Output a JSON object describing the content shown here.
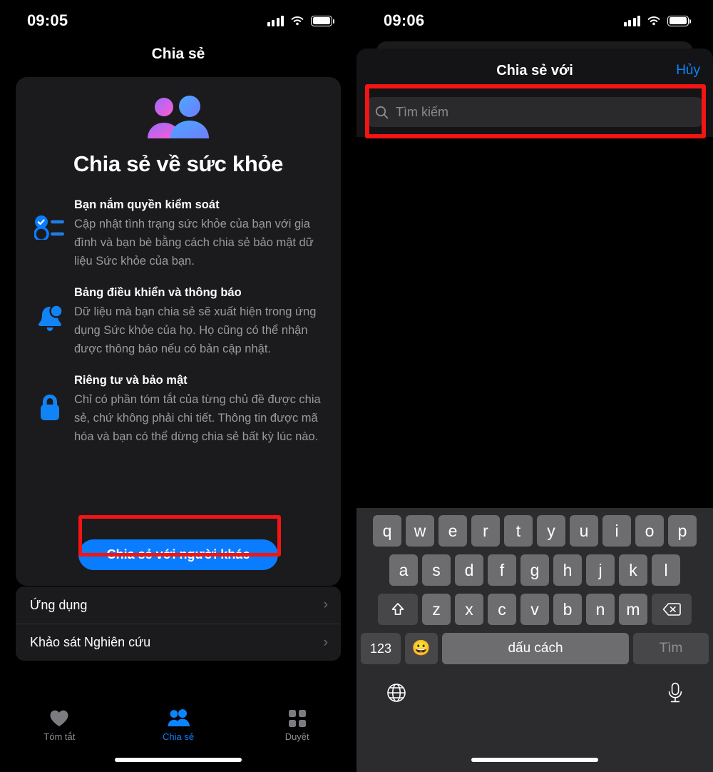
{
  "left": {
    "status": {
      "time": "09:05",
      "cellular_icon": "signal-bars-icon",
      "wifi_icon": "wifi-icon",
      "battery_icon": "battery-icon"
    },
    "nav_title": "Chia sẻ",
    "hero": {
      "icon": "two-people-icon",
      "title": "Chia sẻ về sức khỏe"
    },
    "features": [
      {
        "icon": "checklist-icon",
        "heading": "Bạn nắm quyền kiểm soát",
        "body": "Cập nhật tình trạng sức khỏe của bạn với gia đình và bạn bè bằng cách chia sẻ bảo mật dữ liệu Sức khỏe của bạn."
      },
      {
        "icon": "bell-badge-icon",
        "heading": "Bảng điều khiển và thông báo",
        "body": "Dữ liệu mà bạn chia sẻ sẽ xuất hiện trong ứng dụng Sức khỏe của họ. Họ cũng có thể nhận được thông báo nếu có bản cập nhật."
      },
      {
        "icon": "lock-icon",
        "heading": "Riêng tư và bảo mật",
        "body": "Chỉ có phần tóm tắt của từng chủ đề được chia sẻ, chứ không phải chi tiết. Thông tin được mã hóa và bạn có thể dừng chia sẻ bất kỳ lúc nào."
      }
    ],
    "cta_label": "Chia sẻ với người khác",
    "list": [
      {
        "label": "Ứng dụng",
        "chevron": "chevron-right-icon"
      },
      {
        "label": "Khảo sát Nghiên cứu",
        "chevron": "chevron-right-icon"
      }
    ],
    "tabs": [
      {
        "label": "Tóm tắt",
        "icon": "heart-icon",
        "active": false
      },
      {
        "label": "Chia sẻ",
        "icon": "two-people-icon",
        "active": true
      },
      {
        "label": "Duyệt",
        "icon": "grid-icon",
        "active": false
      }
    ]
  },
  "right": {
    "status": {
      "time": "09:06",
      "cellular_icon": "signal-bars-icon",
      "wifi_icon": "wifi-icon",
      "battery_icon": "battery-icon"
    },
    "sheet": {
      "title": "Chia sẻ với",
      "cancel_label": "Hủy",
      "search": {
        "icon": "search-icon",
        "placeholder": "Tìm kiếm",
        "value": ""
      }
    },
    "keyboard": {
      "row1": [
        "q",
        "w",
        "e",
        "r",
        "t",
        "y",
        "u",
        "i",
        "o",
        "p"
      ],
      "row2": [
        "a",
        "s",
        "d",
        "f",
        "g",
        "h",
        "j",
        "k",
        "l"
      ],
      "row3_letters": [
        "z",
        "x",
        "c",
        "v",
        "b",
        "n",
        "m"
      ],
      "shift_icon": "shift-up-arrow-icon",
      "backspace_icon": "backspace-delete-icon",
      "numbers_label": "123",
      "emoji_icon": "smiley-face-icon",
      "space_label": "dấu cách",
      "return_label": "Tìm",
      "globe_icon": "globe-language-icon",
      "mic_icon": "microphone-icon"
    }
  },
  "colors": {
    "accent_blue": "#0a84ff",
    "highlight_red": "#f31414",
    "card_bg": "#1b1b1d",
    "key_bg": "#6d6d70",
    "keyboard_bg": "#2c2c2e",
    "muted_text": "#9a9a9e"
  }
}
